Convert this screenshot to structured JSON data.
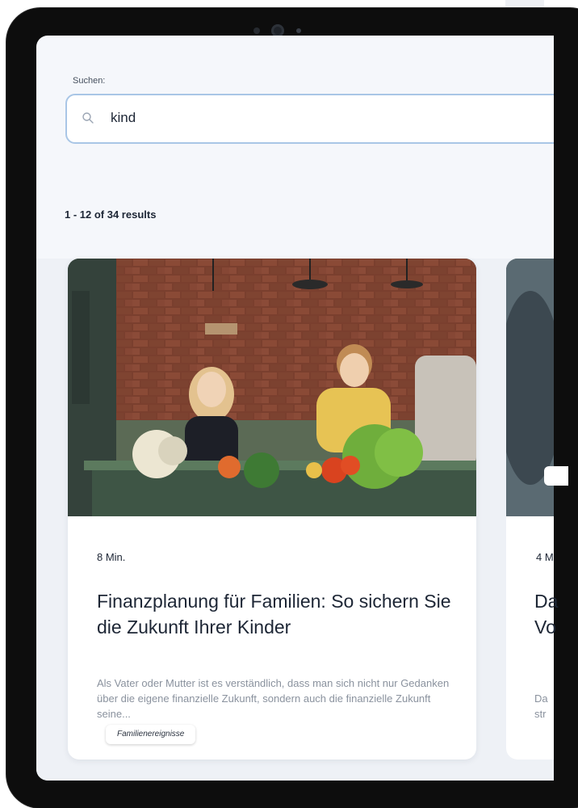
{
  "search": {
    "label": "Suchen:",
    "value": "kind"
  },
  "results": {
    "summary": "1 - 12 of 34 results"
  },
  "cards": [
    {
      "tag": "Familienereignisse",
      "read_time": "8 Min.",
      "title": "Finanzplanung für Familien: So sichern Sie die Zukunft Ihrer Kinder",
      "excerpt": "Als Vater oder Mutter ist es verständlich, dass man sich nicht nur Gedanken über die eigene finanzielle Zukunft, sondern auch die finanzielle Zukunft seine..."
    },
    {
      "read_time": "4 M",
      "title": "Da\nVo",
      "excerpt": "Da\nstr"
    }
  ],
  "icons": {
    "search": "search-icon"
  },
  "colors": {
    "search_border": "#a9c6e6",
    "text": "#1d2635",
    "muted": "#8a929e"
  }
}
